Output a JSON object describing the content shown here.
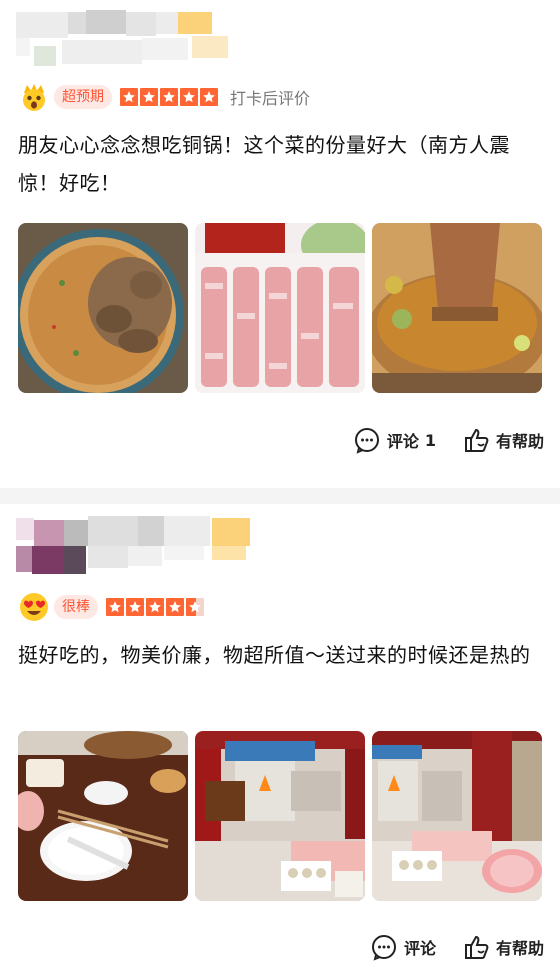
{
  "reviews": [
    {
      "badge": "超预期",
      "badge_emoji": "astonished-face-icon",
      "stars": 5,
      "note": "打卡后评价",
      "text": "朋友心心念念想吃铜锅！这个菜的份量好大（南方人震惊！好吃！",
      "photos": [
        "lamb-stew-dish",
        "sliced-lamb-platter",
        "copper-hotpot"
      ],
      "comment_label": "评论",
      "comment_count": "1",
      "helpful_label": "有帮助"
    },
    {
      "badge": "很棒",
      "badge_emoji": "heart-eyes-face-icon",
      "stars": 4.5,
      "note": "",
      "text": "挺好吃的，物美价廉，物超所值～送过来的时候还是热的",
      "photos": [
        "hotpot-table-setting",
        "restaurant-interior",
        "restaurant-interior-2"
      ],
      "comment_label": "评论",
      "comment_count": "",
      "helpful_label": "有帮助"
    }
  ],
  "colors": {
    "star": "#ff6633",
    "badge1_bg": "#fde8e4",
    "badge1_text": "#ff5533",
    "badge2_bg": "#fde8e4",
    "badge2_text": "#ff5533",
    "separator": "#f4f4f4"
  }
}
